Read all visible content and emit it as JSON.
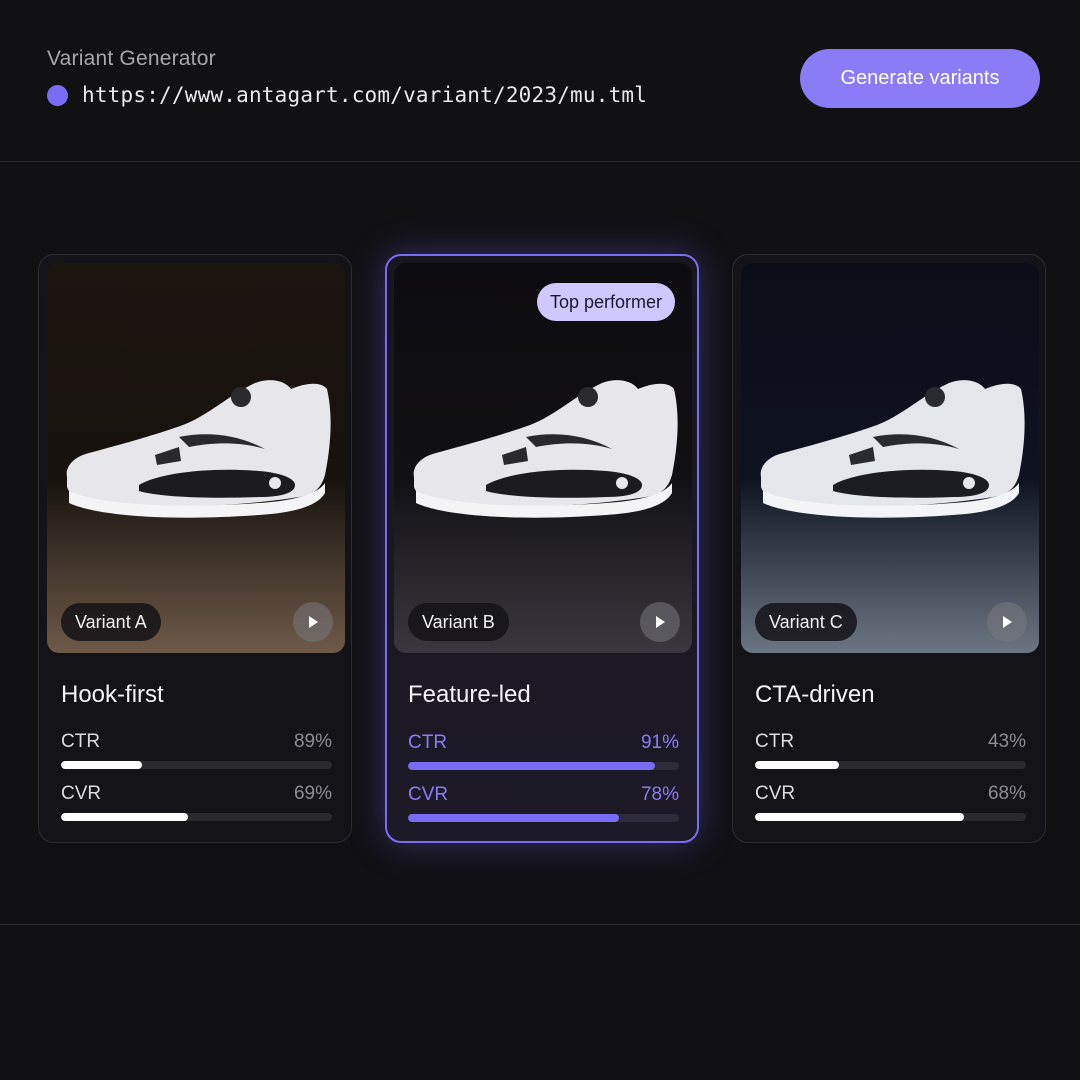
{
  "header": {
    "title": "Variant Generator",
    "url": "https://www.antagart.com/variant/2023/mu.tml",
    "generate_label": "Generate variants",
    "accent": "#8a7cf6"
  },
  "cards": [
    {
      "variant": "Variant A",
      "title": "Hook-first",
      "ctr_label": "CTR",
      "ctr_value": "89%",
      "ctr_fill": 0.3,
      "cvr_label": "CVR",
      "cvr_value": "69%",
      "cvr_fill": 0.47,
      "background": "warm"
    },
    {
      "variant": "Variant B",
      "title": "Feature-led",
      "badge": "Top performer",
      "ctr_label": "CTR",
      "ctr_value": "91%",
      "ctr_fill": 0.91,
      "cvr_label": "CVR",
      "cvr_value": "78%",
      "cvr_fill": 0.78,
      "background": "dark",
      "highlighted": true
    },
    {
      "variant": "Variant C",
      "title": "CTA-driven",
      "ctr_label": "CTR",
      "ctr_value": "43%",
      "ctr_fill": 0.31,
      "cvr_label": "CVR",
      "cvr_value": "68%",
      "cvr_fill": 0.77,
      "background": "cool"
    }
  ],
  "icons": {
    "status_dot": "status-dot-icon",
    "play": "play-icon",
    "product": "sneaker-image"
  }
}
